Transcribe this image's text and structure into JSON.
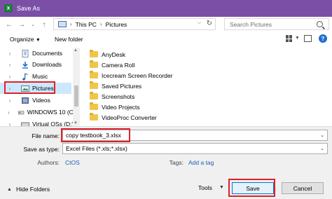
{
  "window": {
    "title": "Save As",
    "app_icon_letter": "X"
  },
  "address": {
    "crumbs": [
      "This PC",
      "Pictures"
    ]
  },
  "search": {
    "placeholder": "Search Pictures"
  },
  "toolbar": {
    "organize": "Organize",
    "new_folder": "New folder",
    "help": "?"
  },
  "nav": {
    "items": [
      {
        "label": "Documents",
        "icon": "documents-icon"
      },
      {
        "label": "Downloads",
        "icon": "downloads-icon"
      },
      {
        "label": "Music",
        "icon": "music-icon"
      },
      {
        "label": "Pictures",
        "icon": "pictures-icon",
        "selected": true
      },
      {
        "label": "Videos",
        "icon": "videos-icon"
      },
      {
        "label": "WINDOWS 10 (C:)",
        "icon": "drive-icon"
      },
      {
        "label": "Virtual OSs (D:)",
        "icon": "drive-icon"
      }
    ]
  },
  "files": [
    {
      "label": "AnyDesk"
    },
    {
      "label": "Camera Roll"
    },
    {
      "label": "Icecream Screen Recorder"
    },
    {
      "label": "Saved Pictures"
    },
    {
      "label": "Screenshots"
    },
    {
      "label": "Video Projects"
    },
    {
      "label": "VideoProc Converter"
    }
  ],
  "save": {
    "file_name_label": "File name:",
    "file_name_value": "copy testbook_3.xlsx",
    "type_label": "Save as type:",
    "type_value": "Excel Files (*.xls;*.xlsx)",
    "authors_label": "Authors:",
    "authors_value": "CtOS",
    "tags_label": "Tags:",
    "tags_value": "Add a tag",
    "hide_folders": "Hide Folders",
    "tools": "Tools",
    "save_button": "Save",
    "cancel_button": "Cancel"
  },
  "colors": {
    "titlebar": "#7b4fa6",
    "highlight": "#e0202a",
    "selection": "#cce8ff",
    "link": "#1a5cb8"
  }
}
